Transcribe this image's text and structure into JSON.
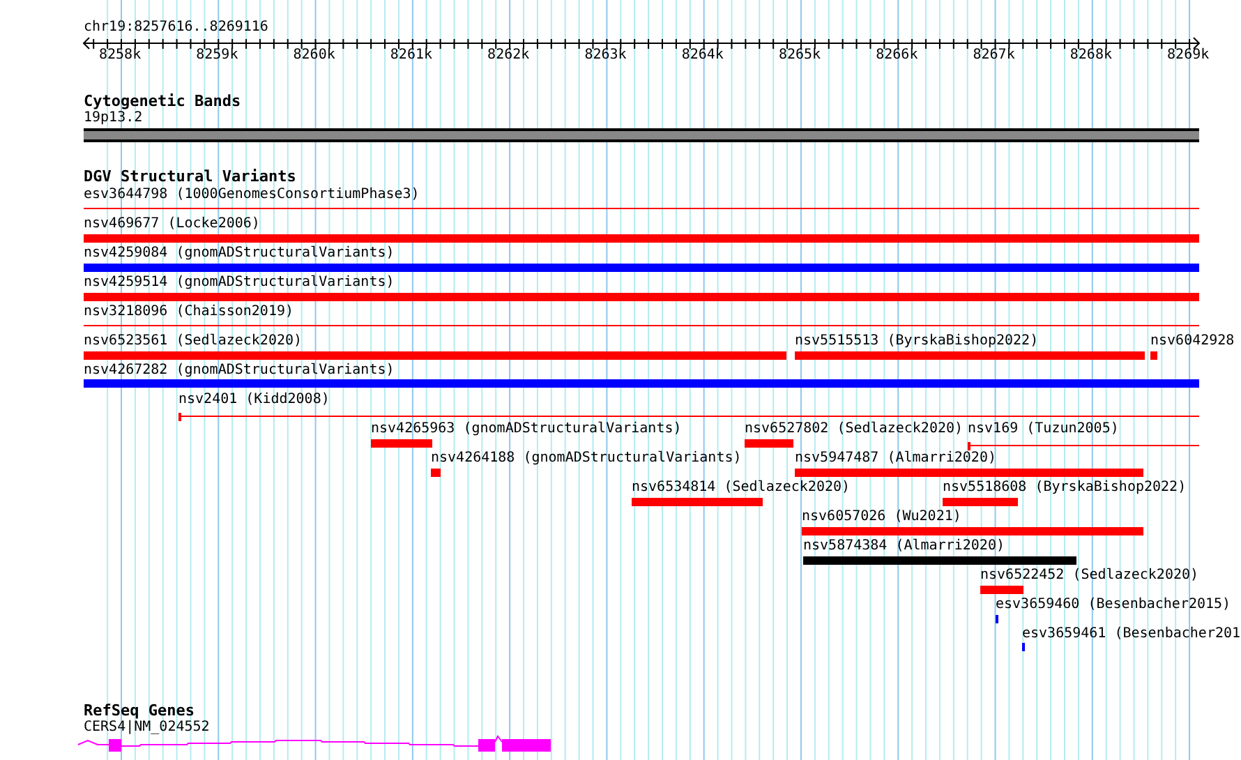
{
  "location": "chr19:8257616..8269116",
  "ruler": {
    "ticks": [
      "8258k",
      "8259k",
      "8260k",
      "8261k",
      "8262k",
      "8263k",
      "8264k",
      "8265k",
      "8266k",
      "8267k",
      "8268k",
      "8269k"
    ]
  },
  "tracks": [
    {
      "kind": "bands",
      "title": "Cytogenetic Bands",
      "features": [
        {
          "label": "19p13.2"
        }
      ]
    },
    {
      "kind": "variants",
      "title": "DGV Structural Variants",
      "features": [
        {
          "label": "esv3644798 (1000GenomesConsortiumPhase3)",
          "kind": "line",
          "color": "#ff0000"
        },
        {
          "label": "nsv469677 (Locke2006)",
          "kind": "bar",
          "color": "#ff0000"
        },
        {
          "label": "nsv4259084 (gnomADStructuralVariants)",
          "kind": "bar",
          "color": "#0000ff"
        },
        {
          "label": "nsv4259514 (gnomADStructuralVariants)",
          "kind": "bar",
          "color": "#ff0000"
        },
        {
          "label": "nsv3218096 (Chaisson2019)",
          "kind": "line",
          "color": "#ff0000"
        },
        {
          "label": "nsv6523561 (Sedlazeck2020)",
          "kind": "bar",
          "color": "#ff0000"
        },
        {
          "label": "nsv5515513 (ByrskaBishop2022)",
          "kind": "bar",
          "color": "#ff0000"
        },
        {
          "label": "nsv6042928",
          "kind": "bar",
          "color": "#ff0000"
        },
        {
          "label": "nsv4267282 (gnomADStructuralVariants)",
          "kind": "bar",
          "color": "#0000ff"
        },
        {
          "label": "nsv2401 (Kidd2008)",
          "kind": "span",
          "color": "#ff0000"
        },
        {
          "label": "nsv4265963 (gnomADStructuralVariants)",
          "kind": "bar",
          "color": "#ff0000"
        },
        {
          "label": "nsv6527802 (Sedlazeck2020)",
          "kind": "bar",
          "color": "#ff0000"
        },
        {
          "label": "nsv169 (Tuzun2005)",
          "kind": "span",
          "color": "#ff0000"
        },
        {
          "label": "nsv4264188 (gnomADStructuralVariants)",
          "kind": "bar",
          "color": "#ff0000"
        },
        {
          "label": "nsv5947487 (Almarri2020)",
          "kind": "bar",
          "color": "#ff0000"
        },
        {
          "label": "nsv6534814 (Sedlazeck2020)",
          "kind": "bar",
          "color": "#ff0000"
        },
        {
          "label": "nsv5518608 (ByrskaBishop2022)",
          "kind": "bar",
          "color": "#ff0000"
        },
        {
          "label": "nsv6057026 (Wu2021)",
          "kind": "bar",
          "color": "#ff0000"
        },
        {
          "label": "nsv5874384 (Almarri2020)",
          "kind": "bar",
          "color": "#000000"
        },
        {
          "label": "nsv6522452 (Sedlazeck2020)",
          "kind": "bar",
          "color": "#ff0000"
        },
        {
          "label": "esv3659460 (Besenbacher2015)",
          "kind": "tick",
          "color": "#0000ff"
        },
        {
          "label": "esv3659461 (Besenbacher201",
          "kind": "tick",
          "color": "#0000ff"
        }
      ]
    },
    {
      "kind": "genes",
      "title": "RefSeq Genes",
      "features": [
        {
          "label": "CERS4|NM_024552"
        }
      ]
    }
  ]
}
